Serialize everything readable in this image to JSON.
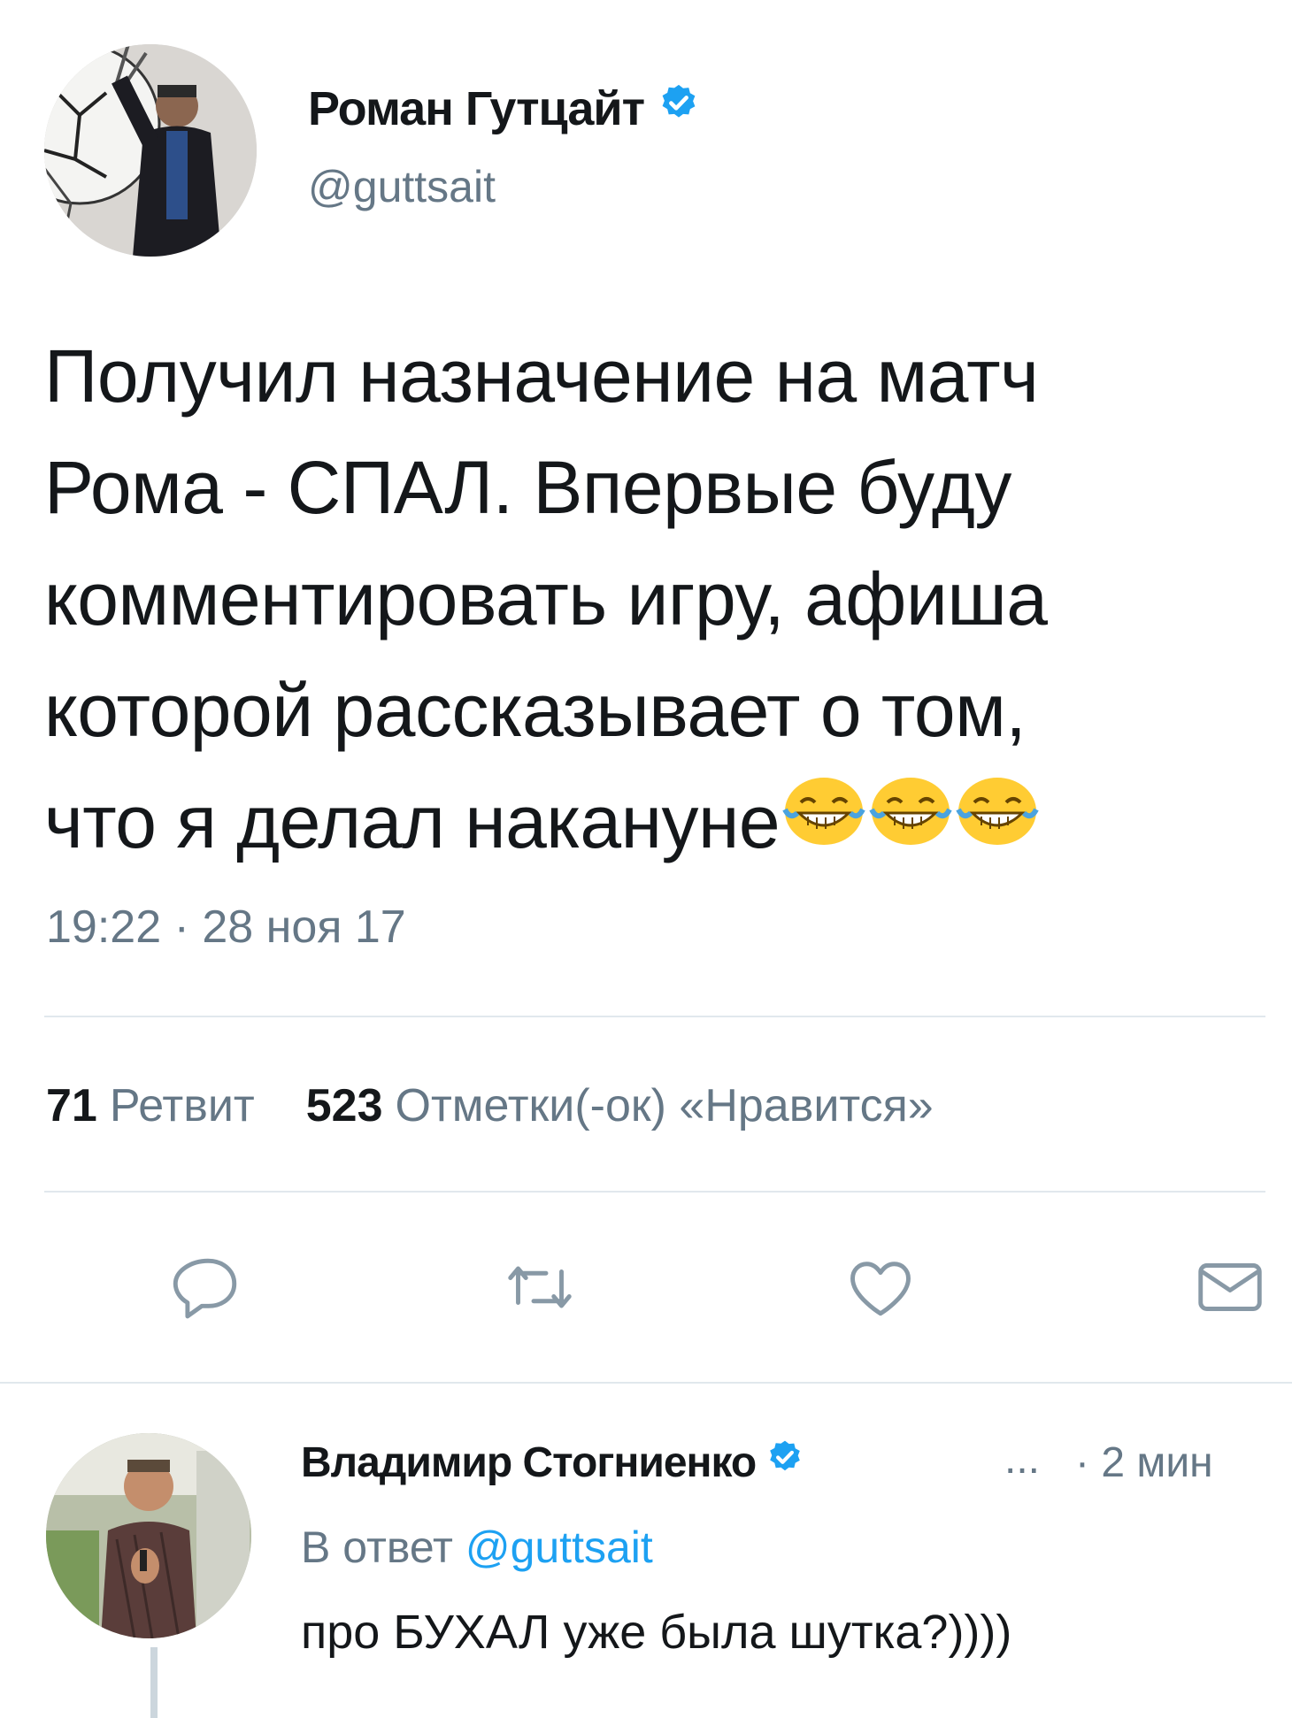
{
  "tweet": {
    "author": {
      "name": "Роман Гутцайт",
      "handle": "@guttsait",
      "verified": true
    },
    "text": "Получил назначение на матч\nРома - СПАЛ. Впервые буду\nкомментировать игру, афиша\nкоторой рассказывает о том,\nчто я делал накануне",
    "emoji": [
      "face-with-tears-of-joy",
      "face-with-tears-of-joy",
      "face-with-tears-of-joy"
    ],
    "timestamp": "19:22 · 28 ноя 17",
    "stats": {
      "retweets_count": "71",
      "retweets_label": "Ретвит",
      "likes_count": "523",
      "likes_label": "Отметки(-ок) «Нравится»"
    },
    "actions": [
      "reply-icon",
      "retweet-icon",
      "like-icon",
      "dm-icon"
    ]
  },
  "reply": {
    "author": {
      "name": "Владимир Стогниенко",
      "verified": true
    },
    "more": "...",
    "time": "· 2 мин",
    "in_reply_prefix": "В ответ",
    "in_reply_mention": "@guttsait",
    "text": "про БУХАЛ уже была шутка?))))"
  },
  "colors": {
    "text": "#14171a",
    "secondary": "#657786",
    "accent": "#1da1f2",
    "divider": "#e1e8ed",
    "icon": "#8899a6",
    "emoji_yellow": "#ffcc33"
  }
}
